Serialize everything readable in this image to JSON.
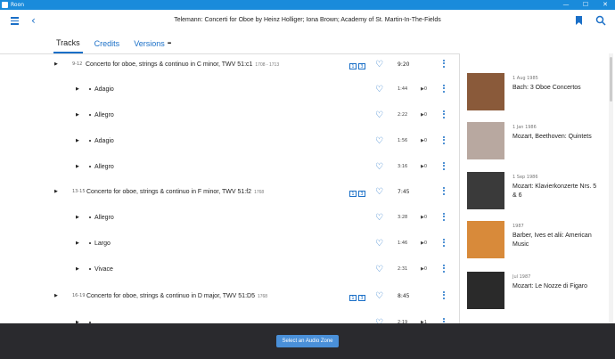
{
  "window": {
    "app_title": "Roon",
    "minimize": "—",
    "maximize": "☐",
    "close": "✕"
  },
  "header": {
    "title": "Telemann: Concerti for Oboe by Heinz Holliger; Iona Brown; Academy of St. Martin-In-The-Fields"
  },
  "tabs": [
    {
      "label": "Tracks"
    },
    {
      "label": "Credits"
    },
    {
      "label": "Versions"
    }
  ],
  "tracks": [
    {
      "kind": "work",
      "num": "9-12",
      "title": "Concerto for oboe, strings & continuo in C minor, TWV 51:c1",
      "year": "1708 - 1713",
      "fmt_top": "1",
      "fmt_bottom": "3",
      "duration": "9:20"
    },
    {
      "kind": "mvt",
      "title": "Adagio",
      "duration": "1:44",
      "plays": "0"
    },
    {
      "kind": "mvt",
      "title": "Allegro",
      "duration": "2:22",
      "plays": "0"
    },
    {
      "kind": "mvt",
      "title": "Adagio",
      "duration": "1:56",
      "plays": "0"
    },
    {
      "kind": "mvt",
      "title": "Allegro",
      "duration": "3:16",
      "plays": "0"
    },
    {
      "kind": "work",
      "num": "13-15",
      "title": "Concerto for oboe, strings & continuo in F minor, TWV 51:f2",
      "year": "1768",
      "fmt_top": "1",
      "fmt_bottom": "3",
      "duration": "7:45"
    },
    {
      "kind": "mvt",
      "title": "Allegro",
      "duration": "3:28",
      "plays": "0"
    },
    {
      "kind": "mvt",
      "title": "Largo",
      "duration": "1:46",
      "plays": "0"
    },
    {
      "kind": "mvt",
      "title": "Vivace",
      "duration": "2:31",
      "plays": "0"
    },
    {
      "kind": "work",
      "num": "16-19",
      "title": "Concerto for oboe, strings & continuo in D major, TWV 51:D5",
      "year": "1768",
      "fmt_top": "1",
      "fmt_bottom": "3",
      "duration": "8:45"
    },
    {
      "kind": "mvt",
      "title": "",
      "duration": "2:19",
      "plays": "1"
    }
  ],
  "albums": [
    {
      "date": "1 Aug 1985",
      "name": "Bach: 3 Oboe Concertos",
      "color": "#8a5a3a"
    },
    {
      "date": "1 Jan 1986",
      "name": "Mozart, Beethoven: Quintets",
      "color": "#b8a8a0"
    },
    {
      "date": "1 Sep 1986",
      "name": "Mozart: Klavierkonzerte Nrs. 5 & 6",
      "color": "#3a3a3a"
    },
    {
      "date": "1987",
      "name": "Barber, Ives et alii: American Music",
      "color": "#d88a3a"
    },
    {
      "date": "Jul 1987",
      "name": "Mozart: Le Nozze di Figaro",
      "color": "#2a2a2a"
    }
  ],
  "bottom": {
    "zone_label": "Select an Audio Zone"
  },
  "colors": {
    "accent": "#1a6fc7",
    "titlebar": "#1a8bdb",
    "bottombar": "#2a2a2e"
  }
}
